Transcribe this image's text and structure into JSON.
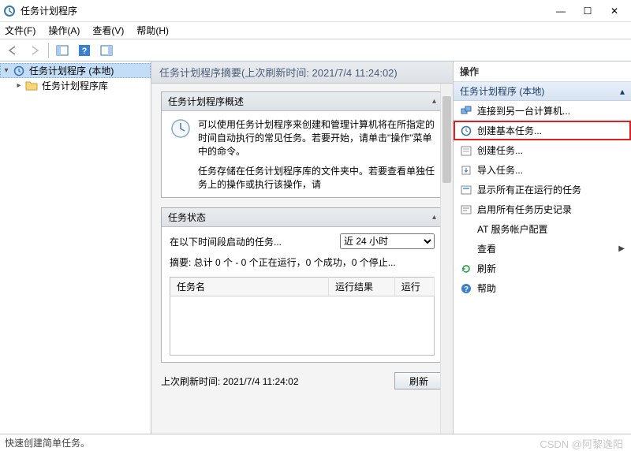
{
  "window": {
    "title": "任务计划程序",
    "minimize": "—",
    "maximize": "☐",
    "close": "✕"
  },
  "menubar": {
    "file": "文件(F)",
    "action": "操作(A)",
    "view": "查看(V)",
    "help": "帮助(H)"
  },
  "tree": {
    "root": "任务计划程序 (本地)",
    "library": "任务计划程序库"
  },
  "center": {
    "header": "任务计划程序摘要(上次刷新时间: 2021/7/4 11:24:02)",
    "overview_title": "任务计划程序概述",
    "overview_text_1": "可以使用任务计划程序来创建和管理计算机将在所指定的时间自动执行的常见任务。若要开始，请单击\"操作\"菜单中的命令。",
    "overview_text_2": "任务存储在任务计划程序库的文件夹中。若要查看单独任务上的操作或执行该操作，请",
    "status_title": "任务状态",
    "status_label": "在以下时间段启动的任务...",
    "status_options": [
      "近 24 小时"
    ],
    "summary": "摘要: 总计 0 个 - 0 个正在运行，0 个成功，0 个停止...",
    "col_name": "任务名",
    "col_result": "运行结果",
    "col_run": "运行",
    "last_refresh": "上次刷新时间: 2021/7/4 11:24:02",
    "refresh_btn": "刷新"
  },
  "actions": {
    "header": "操作",
    "section": "任务计划程序 (本地)",
    "items": [
      {
        "label": "连接到另一台计算机...",
        "icon": "connect"
      },
      {
        "label": "创建基本任务...",
        "icon": "create-basic",
        "highlight": true
      },
      {
        "label": "创建任务...",
        "icon": "create"
      },
      {
        "label": "导入任务...",
        "icon": "import"
      },
      {
        "label": "显示所有正在运行的任务",
        "icon": "running"
      },
      {
        "label": "启用所有任务历史记录",
        "icon": "history"
      },
      {
        "label": "AT 服务帐户配置",
        "icon": "at"
      },
      {
        "label": "查看",
        "icon": "view",
        "arrow": true
      },
      {
        "label": "刷新",
        "icon": "refresh"
      },
      {
        "label": "帮助",
        "icon": "help"
      }
    ]
  },
  "statusbar": "快速创建简单任务。",
  "watermark": "CSDN @阿黎逸阳"
}
